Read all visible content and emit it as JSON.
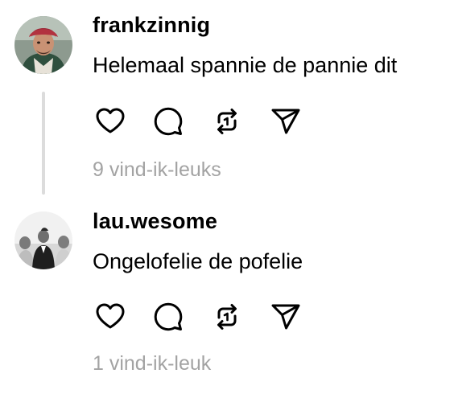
{
  "comments": [
    {
      "username": "frankzinnig",
      "text": "Helemaal spannie de pannie dit",
      "likes_label": "9 vind-ik-leuks",
      "avatar_icon": "profile-photo"
    },
    {
      "username": "lau.wesome",
      "text": "Ongelofelie de pofelie",
      "likes_label": "1 vind-ik-leuk",
      "avatar_icon": "profile-photo"
    }
  ],
  "actions": [
    "heart-icon",
    "comment-icon",
    "repost-icon",
    "send-icon"
  ],
  "colors": {
    "text": "#000000",
    "muted": "#a3a3a3",
    "thread_line": "#dcdcdc",
    "background": "#ffffff"
  }
}
